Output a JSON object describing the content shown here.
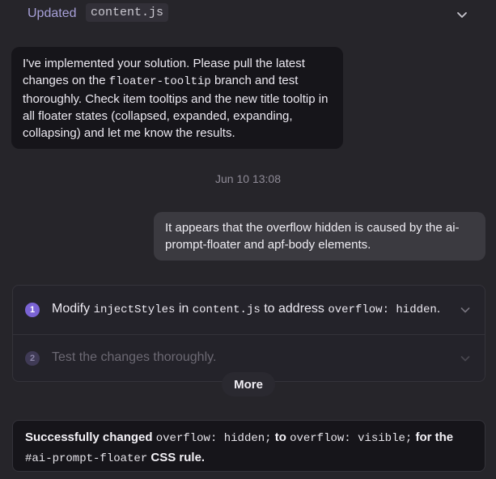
{
  "header": {
    "updated_label": "Updated",
    "file_name": "content.js"
  },
  "assistant_message": {
    "part1": "I've implemented your solution. Please pull the latest changes on the ",
    "code1": "floater-tooltip",
    "part2": " branch and test thoroughly. Check item tooltips and the new title tooltip in all floater states (collapsed, expanded, expanding, collapsing) and let me know the results."
  },
  "timestamp": "Jun 10 13:08",
  "user_message": "It appears that the overflow hidden is caused by the ai-prompt-floater and apf-body elements.",
  "plan": {
    "steps": [
      {
        "number": "1",
        "t1": "Modify ",
        "c1": "injectStyles",
        "t2": " in ",
        "c2": "content.js",
        "t3": " to address ",
        "c3": "overflow: hidden",
        "t4": "."
      },
      {
        "number": "2",
        "text": "Test the changes thoroughly."
      }
    ],
    "more_label": "More"
  },
  "success_message": {
    "t1": "Successfully changed ",
    "c1": "overflow: hidden;",
    "t2": " to ",
    "c2": "overflow: visible;",
    "t3": " for the ",
    "c3": "#ai-prompt-floater",
    "t4": " CSS rule."
  },
  "colors": {
    "background": "#26252a",
    "accent": "#7a63d4",
    "bubble_dark": "#16151a",
    "bubble_user": "#3b3a40"
  },
  "icons": {
    "header_toggle": "chevron-down-icon",
    "step_toggle": "chevron-down-icon"
  }
}
